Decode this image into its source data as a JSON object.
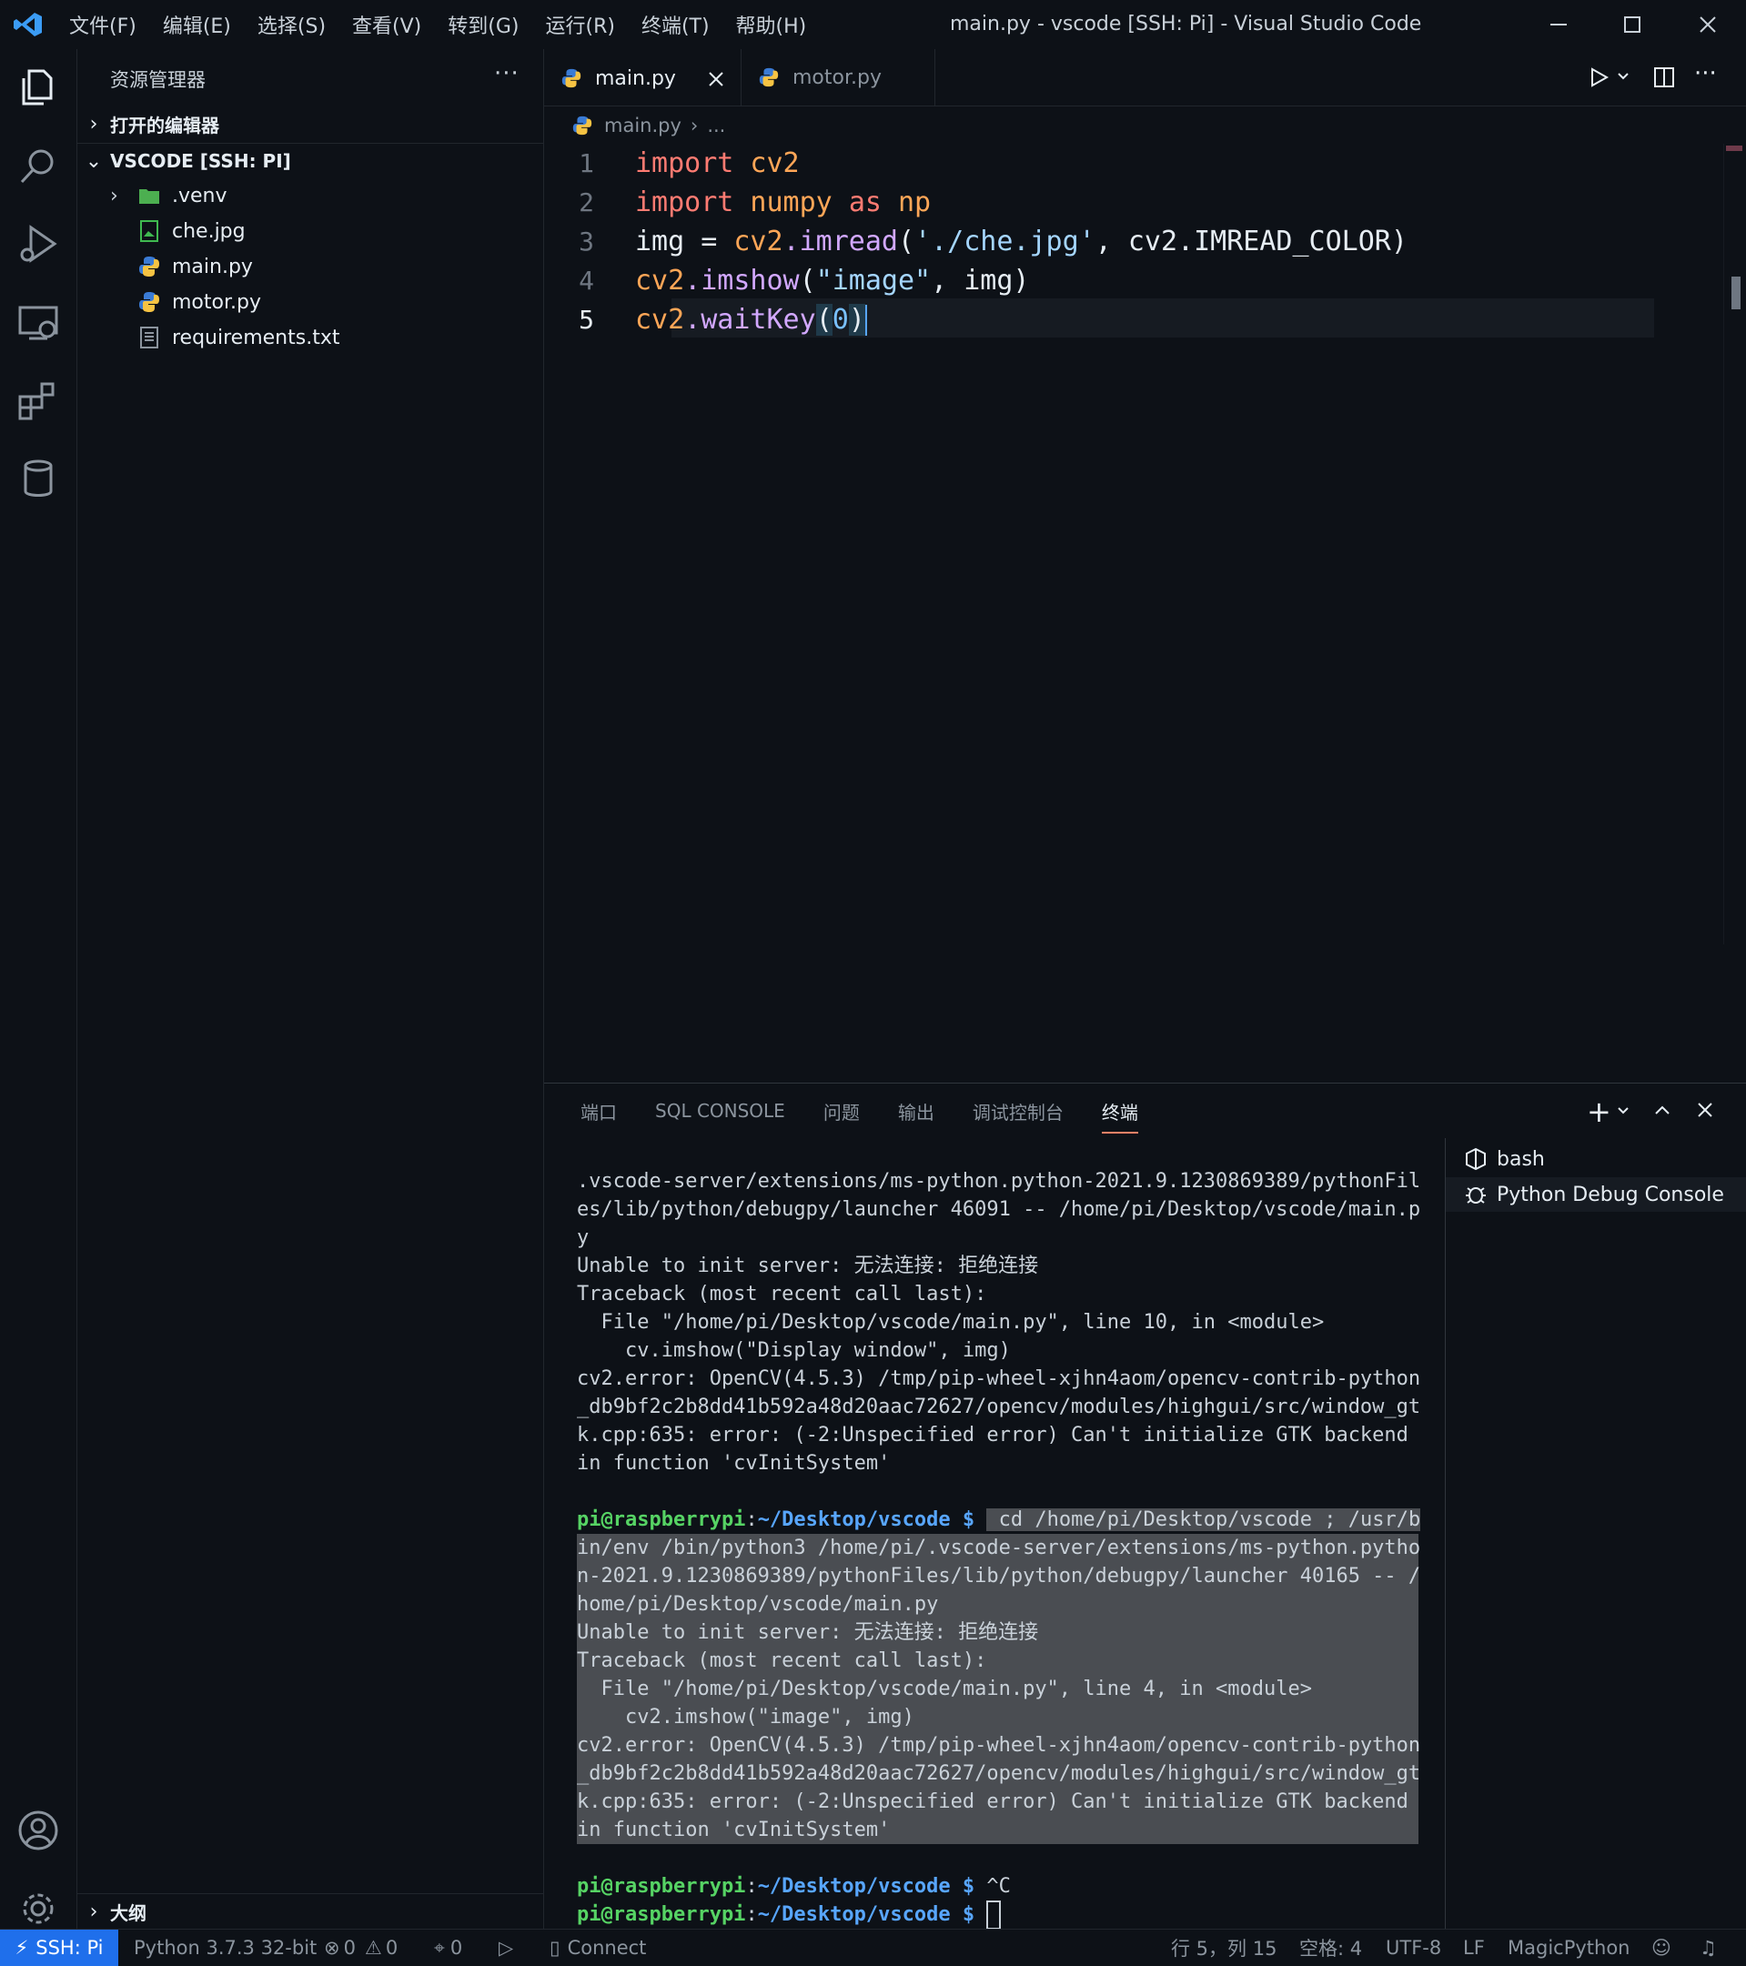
{
  "titlebar": {
    "menu": [
      "文件(F)",
      "编辑(E)",
      "选择(S)",
      "查看(V)",
      "转到(G)",
      "运行(R)",
      "终端(T)",
      "帮助(H)"
    ],
    "title": "main.py - vscode [SSH: Pi] - Visual Studio Code"
  },
  "sidebar": {
    "title": "资源管理器",
    "more": "···",
    "open_editors": "打开的编辑器",
    "workspace": "VSCODE [SSH: PI]",
    "files": [
      ".venv",
      "che.jpg",
      "main.py",
      "motor.py",
      "requirements.txt"
    ],
    "outline": "大纲"
  },
  "tabs": [
    {
      "label": "main.py",
      "active": true
    },
    {
      "label": "motor.py",
      "active": false
    }
  ],
  "breadcrumb": {
    "file": "main.py",
    "rest": "..."
  },
  "code": {
    "lines": [
      {
        "n": "1",
        "kw": "import",
        "rest": " cv2"
      },
      {
        "n": "2",
        "kw": "import",
        "mod": " numpy ",
        "as": "as",
        "alias": " np"
      },
      {
        "n": "3",
        "var": "img = ",
        "obj": "cv2",
        "fn": ".imread",
        "s": "'./che.jpg'",
        "tail": ", cv2.IMREAD_COLOR)"
      },
      {
        "n": "4",
        "obj": "cv2",
        "fn": ".imshow",
        "s": "\"image\"",
        "tail": ", img)"
      },
      {
        "n": "5",
        "obj": "cv2",
        "fn": ".waitKey",
        "arg": "0"
      }
    ]
  },
  "panel": {
    "tabs": [
      "端口",
      "SQL CONSOLE",
      "问题",
      "输出",
      "调试控制台",
      "终端"
    ],
    "active_tab": "终端",
    "terminals": [
      "bash",
      "Python Debug Console"
    ],
    "output_1": ".vscode-server/extensions/ms-python.python-2021.9.1230869389/pythonFil\nes/lib/python/debugpy/launcher 46091 -- /home/pi/Desktop/vscode/main.p\ny\nUnable to init server: 无法连接: 拒绝连接\nTraceback (most recent call last):\n  File \"/home/pi/Desktop/vscode/main.py\", line 10, in <module>\n    cv.imshow(\"Display window\", img)\ncv2.error: OpenCV(4.5.3) /tmp/pip-wheel-xjhn4aom/opencv-contrib-python\n_db9bf2c2b8dd41b592a48d20aac72627/opencv/modules/highgui/src/window_gt\nk.cpp:635: error: (-2:Unspecified error) Can't initialize GTK backend\nin function 'cvInitSystem'",
    "prompt_user": "pi@raspberrypi",
    "prompt_colon": ":",
    "prompt_path": "~/Desktop/vscode $",
    "cmd_head": " cd /home/pi/Desktop/vscode ; /usr/b",
    "output_2": "in/env /bin/python3 /home/pi/.vscode-server/extensions/ms-python.pytho\nn-2021.9.1230869389/pythonFiles/lib/python/debugpy/launcher 40165 -- /\nhome/pi/Desktop/vscode/main.py\nUnable to init server: 无法连接: 拒绝连接\nTraceback (most recent call last):\n  File \"/home/pi/Desktop/vscode/main.py\", line 4, in <module>\n    cv2.imshow(\"image\", img)\ncv2.error: OpenCV(4.5.3) /tmp/pip-wheel-xjhn4aom/opencv-contrib-python\n_db9bf2c2b8dd41b592a48d20aac72627/opencv/modules/highgui/src/window_gt\nk.cpp:635: error: (-2:Unspecified error) Can't initialize GTK backend\nin function 'cvInitSystem'",
    "ctrl_c": " ^C"
  },
  "status": {
    "remote": "SSH: Pi",
    "python": "Python 3.7.3 32-bit",
    "errors": "0",
    "warnings": "0",
    "ports": "0",
    "connect": "Connect",
    "position": "行 5，列 15",
    "spaces": "空格: 4",
    "encoding": "UTF-8",
    "eol": "LF",
    "language": "MagicPython"
  }
}
